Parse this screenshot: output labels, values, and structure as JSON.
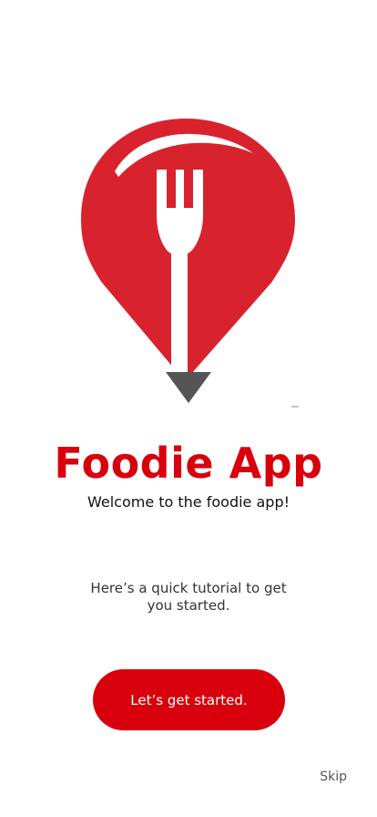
{
  "app": {
    "title": "Foodie App",
    "subtitle": "Welcome to the foodie app!"
  },
  "tutorial": {
    "text": "Here’s a quick tutorial to get you started."
  },
  "actions": {
    "start_label": "Let’s get started.",
    "skip_label": "Skip"
  },
  "logo": {
    "icon": "map-pin-fork-icon",
    "pin_color": "#d8232e",
    "tip_color": "#555555"
  },
  "colors": {
    "brand": "#d8000c",
    "text": "#111111",
    "muted": "#555555"
  }
}
